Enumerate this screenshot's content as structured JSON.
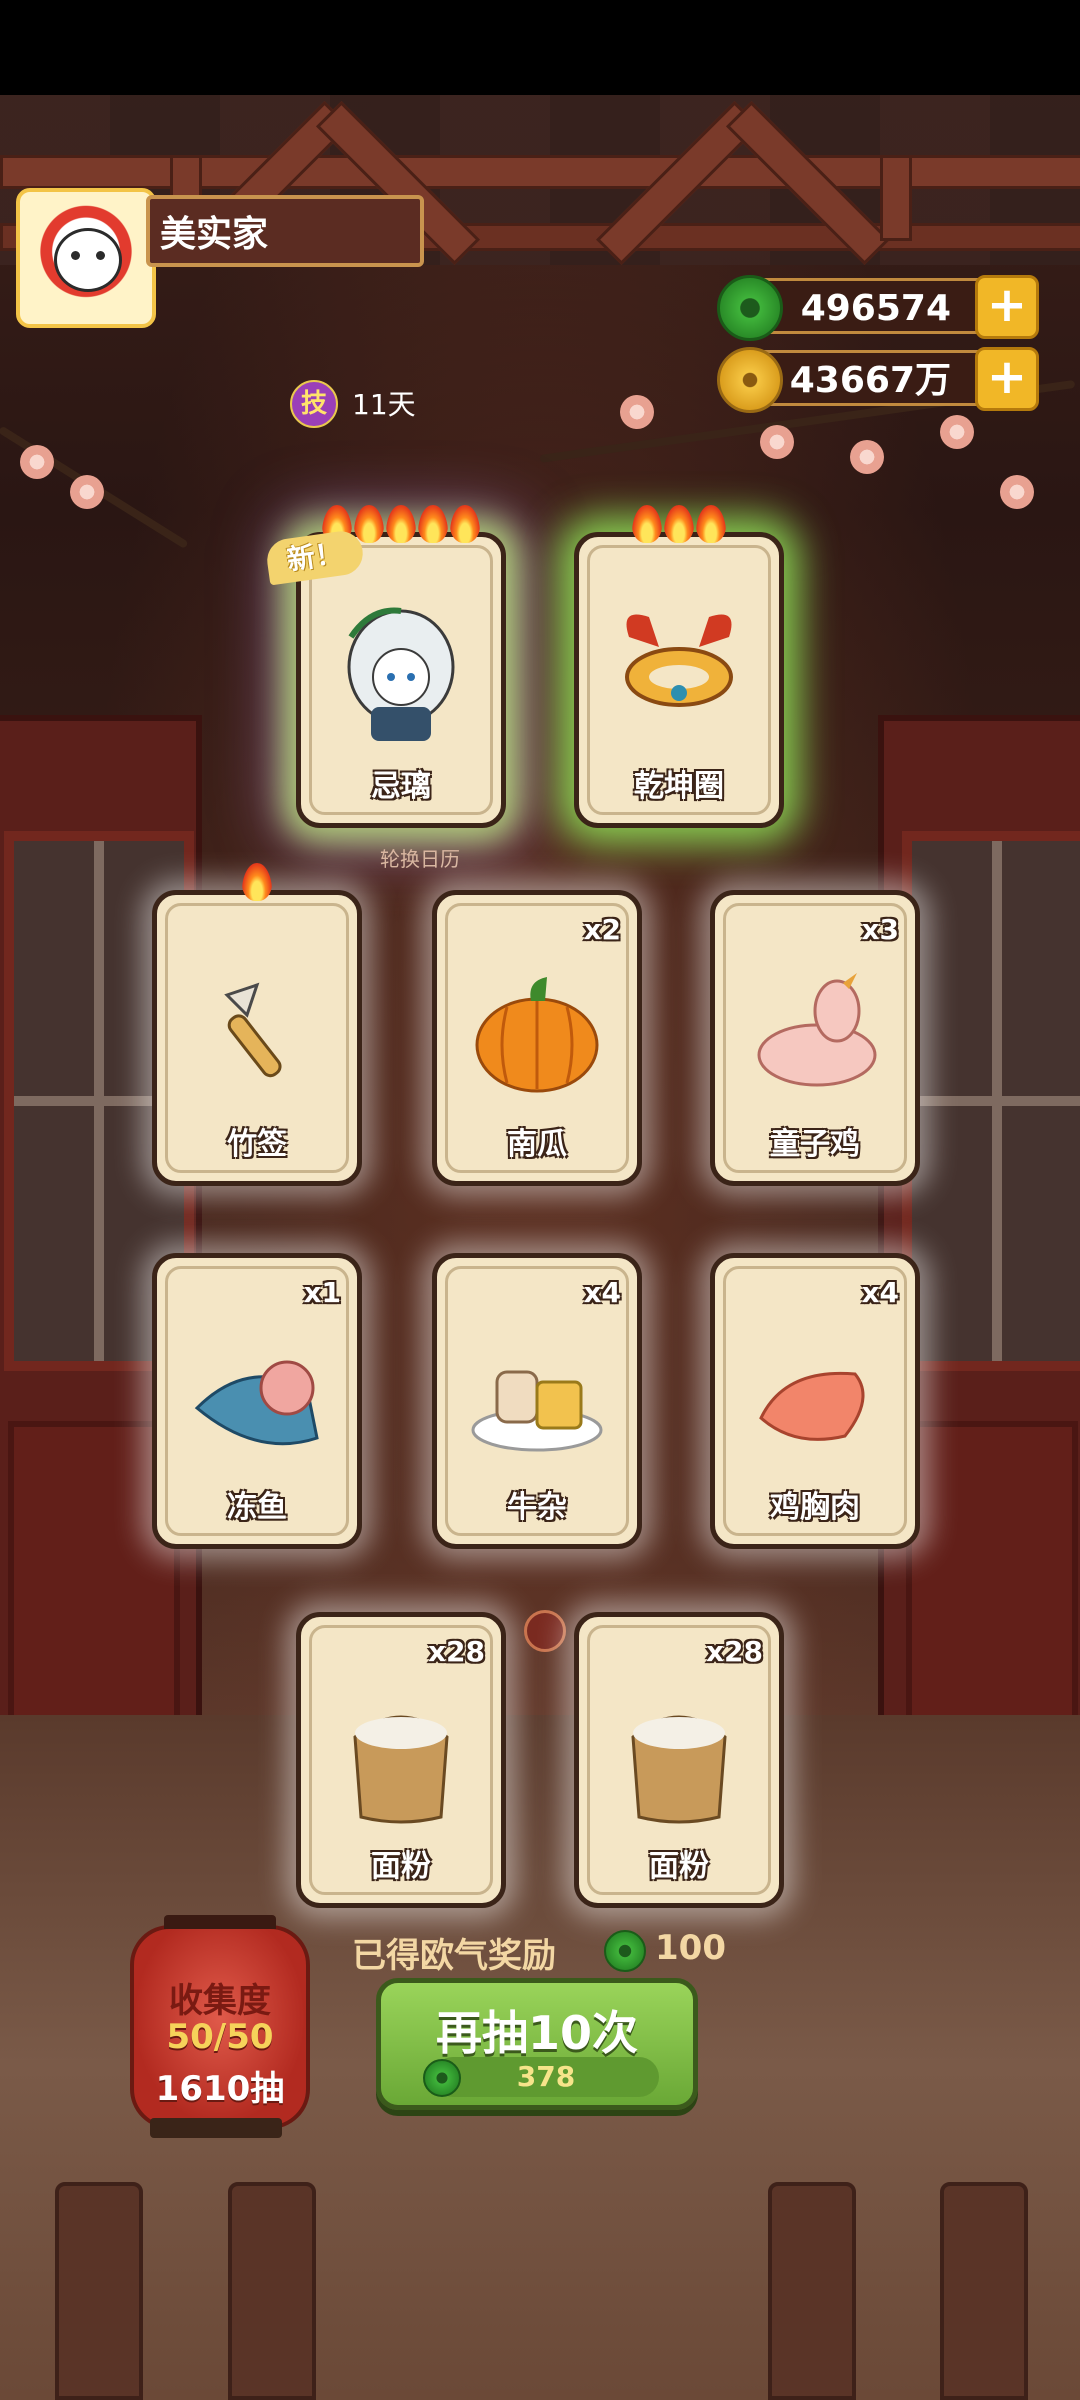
{
  "player": {
    "name": "美实家",
    "skill_icon": "技",
    "days": "11天"
  },
  "currency": {
    "jade": "496574",
    "coins": "43667万"
  },
  "featured": [
    {
      "name": "忌璃",
      "new_tag": "新！",
      "flames": 5
    },
    {
      "name": "乾坤圈",
      "flames": 3
    }
  ],
  "calendar_label": "轮换日历",
  "cards": [
    {
      "name": "竹签",
      "qty": "",
      "flames": 1,
      "art": "skewer-icon"
    },
    {
      "name": "南瓜",
      "qty": "x2",
      "art": "pumpkin-icon"
    },
    {
      "name": "童子鸡",
      "qty": "x3",
      "art": "chicken-icon"
    },
    {
      "name": "冻鱼",
      "qty": "x1",
      "art": "fish-icon"
    },
    {
      "name": "牛杂",
      "qty": "x4",
      "art": "beef-offal-icon"
    },
    {
      "name": "鸡胸肉",
      "qty": "x4",
      "art": "chicken-breast-icon"
    },
    {
      "name": "面粉",
      "qty": "x28",
      "art": "flour-sack-icon"
    },
    {
      "name": "面粉",
      "qty": "x28",
      "art": "flour-sack-icon"
    }
  ],
  "luck_reward": {
    "label": "已得欧气奖励",
    "value": "100"
  },
  "draw_button": {
    "label": "再抽10次",
    "cost": "378"
  },
  "collection": {
    "title": "收集度",
    "progress": "50/50",
    "draws": "1610抽"
  },
  "colors": {
    "accent_gold": "#f1b727",
    "button_green": "#7fc048",
    "rare_glow": "#94eb5a"
  }
}
